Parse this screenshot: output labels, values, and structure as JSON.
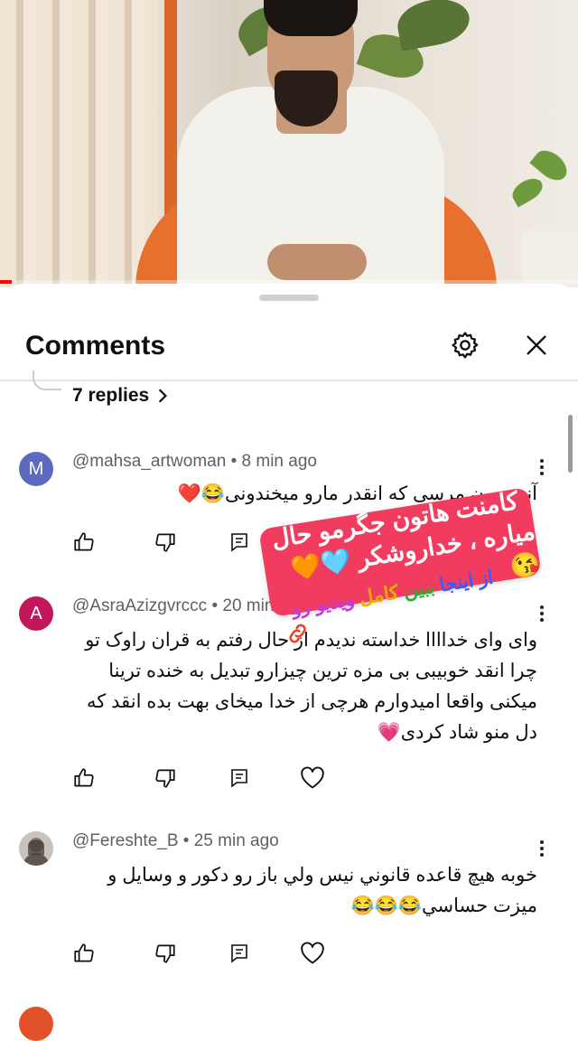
{
  "video": {
    "progress_percent": 2,
    "progress_color": "#ff0000"
  },
  "panel": {
    "title": "Comments"
  },
  "thread": {
    "replies_label": "7 replies"
  },
  "comments": [
    {
      "avatar_letter": "M",
      "avatar_color": "#5c6bc0",
      "author": "@mahsa_artwoman",
      "time": "8 min ago",
      "text": "آنق جون مرسی که انقدر مارو میخندونی😂❤️"
    },
    {
      "avatar_letter": "A",
      "avatar_color": "#c2185b",
      "author": "@AsraAzizgvrccc",
      "time": "20 min ago",
      "text": "وای وای خداااا خداسته ندیدم از حال رفتم به قران راوک تو چرا انقد خوبیبی بی مزه ترین چیزارو تبدیل به خنده ترینا میکنی واقعا امیدوارم هرچی از خدا میخای بهت بده انقد که دل منو شاد کردی💗"
    },
    {
      "avatar_letter": "",
      "avatar_color": "#b9b3ae",
      "author": "@Fereshte_B",
      "time": "25 min ago",
      "text": "خوبه هیچ قاعده قانوني نيس ولي باز رو دکور و وسایل و میزت حساسي😂😂😂"
    }
  ],
  "overlay": {
    "sticker_line1": "کامنت هاتون جگرمو حال",
    "sticker_line2": "میاره ، خداروشکر 🩵🧡😘",
    "sticker_color": "#f23c5f",
    "watch_text": "از اینجا ببین کامل ویدیو رو",
    "watch_words": [
      "از اینجا",
      "ببین",
      "کامل",
      "ویدیو رو"
    ],
    "watch_colors": [
      "#3b5bff",
      "#2eaa2e",
      "#e0b000",
      "#c43bd6"
    ]
  },
  "icons": {
    "settings": "gear-icon",
    "close": "close-icon",
    "like": "thumbs-up-icon",
    "dislike": "thumbs-down-icon",
    "reply": "reply-icon",
    "heart": "heart-icon",
    "more": "more-vertical-icon"
  }
}
